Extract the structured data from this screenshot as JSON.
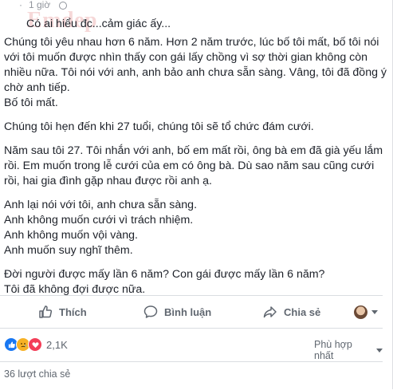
{
  "post": {
    "time": "1 giờ",
    "watermark": "Emdep",
    "paragraphs": [
      [
        "Có ai hiểu đc...cảm giác ấy..."
      ],
      [
        "Chúng tôi yêu nhau hơn 6 năm. Hơn 2 năm trước, lúc bố tôi mất, bố tôi nói",
        "với tôi muốn được nhìn thấy con gái lấy chồng vì sợ thời gian không còn",
        "nhiều nữa. Tôi nói với anh, anh bảo anh chưa sẵn sàng. Vâng, tôi đã đồng ý",
        "chờ anh tiếp.",
        "Bố tôi mất."
      ],
      [
        "Chúng tôi hẹn đến khi 27 tuổi, chúng tôi sẽ tổ chức đám cưới."
      ],
      [
        "Năm sau tôi 27. Tôi nhắn với anh, bố em mất rồi, ông bà em đã già yếu lắm",
        "rồi. Em muốn trong lễ cưới của em có ông bà. Dù sao năm sau cũng cưới",
        "rồi, hai gia đình gặp nhau được rồi anh ạ."
      ],
      [
        "Anh lại nói với tôi, anh chưa sẵn sàng.",
        "Anh không muốn cưới vì trách nhiệm.",
        "Anh không muốn vội vàng.",
        "Anh muốn suy nghĩ thêm."
      ],
      [
        "Đời người được mấy lần 6 năm? Con gái được mấy lần 6 năm?",
        "Tôi đã không đợi được nữa."
      ]
    ]
  },
  "actions": {
    "like_label": "Thích",
    "comment_label": "Bình luận",
    "share_label": "Chia sẻ",
    "like_icon": "thumbs-up-icon",
    "comment_icon": "comment-icon",
    "share_icon": "share-arrow-icon"
  },
  "reactions": {
    "count": "2,1K",
    "types": [
      "like",
      "sad",
      "love"
    ],
    "sort_label": "Phù hợp nhất"
  },
  "shares": {
    "label": "36 lượt chia sẻ"
  },
  "colors": {
    "like": "#1877f2",
    "sad": "#f7b125",
    "love": "#f33e58",
    "action_text": "#606770",
    "body_text": "#1d2129"
  }
}
